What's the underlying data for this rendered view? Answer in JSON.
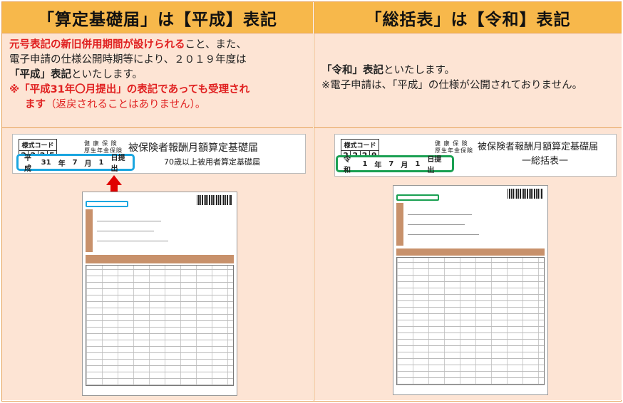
{
  "left": {
    "header": "「算定基礎届」は【平成】表記",
    "desc": {
      "line1_red": "元号表記の新旧併用期間が設けられる",
      "line1_rest": "こと、また、",
      "line2": "電子申請の仕様公開時期等により、２０１９年度は",
      "line3_bold": "「平成」表記",
      "line3_rest": "といたします。",
      "note_line1": "※「平成31年〇月提出」の表記であっても受理され",
      "note_line2_a": "ます",
      "note_line2_b": "（返戻されることはありません）。"
    },
    "form": {
      "code_label": "様式コード",
      "code_digits": [
        "2",
        "2",
        "2",
        "5"
      ],
      "insurance_line1": "健 康 保 険",
      "insurance_line2": "厚生年金保険",
      "title": "被保険者報酬月額算定基礎届",
      "subtitle": "70歳以上被用者算定基礎届",
      "date_parts": [
        "平成",
        "31",
        "年",
        "7",
        "月",
        "1",
        "日提出"
      ]
    }
  },
  "right": {
    "header": "「総括表」は【令和】表記",
    "desc": {
      "line1_bold": "「令和」表記",
      "line1_rest": "といたします。",
      "line2": "※電子申請は、「平成」の仕様が公開されておりません。"
    },
    "form": {
      "code_label": "様式コード",
      "code_digits": [
        "2",
        "2",
        "2",
        "9"
      ],
      "insurance_line1": "健 康 保 険",
      "insurance_line2": "厚生年金保険",
      "title": "被保険者報酬月額算定基礎届",
      "subtitle": "一総括表一",
      "date_parts": [
        "令和",
        "1",
        "年",
        "7",
        "月",
        "1",
        "日提出"
      ]
    }
  },
  "colors": {
    "header_bg": "#f7b84b",
    "desc_bg": "#fde4d4",
    "blue": "#1aa6e0",
    "green": "#1aa052",
    "red": "#e02020"
  }
}
